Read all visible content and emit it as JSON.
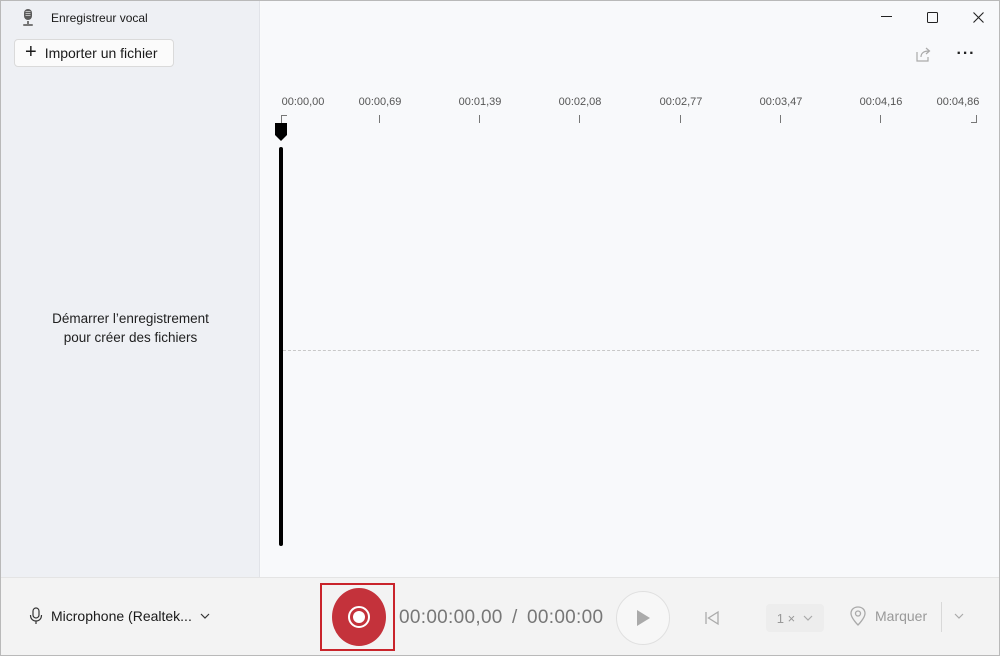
{
  "window": {
    "title": "Enregistreur vocal",
    "controls": {
      "minimize": "—",
      "maximize": "☐",
      "close": "✕"
    }
  },
  "sidebar": {
    "import_label": "Importer un fichier",
    "empty_line1": "Démarrer l’enregistrement",
    "empty_line2": "pour créer des fichiers"
  },
  "toolbar": {
    "more_label": "···"
  },
  "timeline": {
    "ticks": [
      "00:00,00",
      "00:00,69",
      "00:01,39",
      "00:02,08",
      "00:02,77",
      "00:03,47",
      "00:04,16",
      "00:04,86"
    ]
  },
  "player": {
    "microphone_label": "Microphone (Realtek...",
    "time_current": "00:00:00,00",
    "time_separator": "/",
    "time_total": "00:00:00",
    "speed_label": "1 ×",
    "marker_label": "Marquer"
  },
  "colors": {
    "record": "#c4323b",
    "record_frame": "#c9242b"
  },
  "icons": [
    "microphone-app-icon",
    "plus-icon",
    "share-icon",
    "more-icon",
    "microphone-icon",
    "chevron-down-icon",
    "record-icon",
    "play-icon",
    "skip-back-icon",
    "marker-pin-icon"
  ]
}
